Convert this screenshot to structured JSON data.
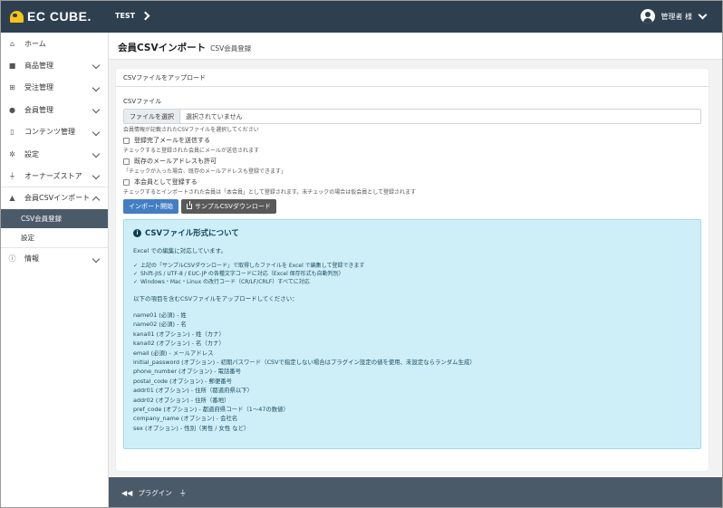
{
  "header": {
    "logo_text": "EC CUBE.",
    "shop_name": "TEST",
    "user_name": "管理者 様"
  },
  "sidebar": {
    "items": [
      {
        "label": "ホーム",
        "icon": "home-icon"
      },
      {
        "label": "商品管理",
        "icon": "box-icon"
      },
      {
        "label": "受注管理",
        "icon": "cart-icon"
      },
      {
        "label": "会員管理",
        "icon": "users-icon"
      },
      {
        "label": "コンテンツ管理",
        "icon": "document-icon"
      },
      {
        "label": "設定",
        "icon": "gear-icon"
      },
      {
        "label": "オーナーズストア",
        "icon": "plug-icon"
      },
      {
        "label": "会員CSVインポート",
        "icon": "user-upload-icon"
      },
      {
        "label": "情報",
        "icon": "info-icon"
      }
    ],
    "sub_items": [
      {
        "label": "CSV会員登録"
      },
      {
        "label": "設定"
      }
    ]
  },
  "page": {
    "title": "会員CSVインポート",
    "subtitle": "CSV会員登録"
  },
  "upload": {
    "card_title": "CSVファイルをアップロード",
    "file_label": "CSVファイル",
    "file_button": "ファイルを選択",
    "file_status": "選択されていません",
    "file_help": "会員情報が記載されたCSVファイルを選択してください",
    "check1": "登録完了メールを送信する",
    "check1_help": "チェックすると登録された会員にメールが送信されます",
    "check2": "既存のメールアドレスも許可",
    "check2_help": "「チェックが入った場合、既存のメールアドレスも登録できます」",
    "check3": "本会員として登録する",
    "check3_help": "チェックするとインポートされた会員は「本会員」として登録されます。未チェックの場合は仮会員として登録されます",
    "import_button": "インポート開始",
    "sample_button": "サンプルCSVダウンロード"
  },
  "info": {
    "title": "CSVファイル形式について",
    "intro": "Excel での編集に対応しています。",
    "features": [
      "上記の「サンプルCSVダウンロード」で取得したファイルを Excel で編集して登録できます",
      "Shift-JIS / UTF-8 / EUC-JP の各種文字コードに対応（Excel 保存形式も自動判別）",
      "Windows・Mac・Linux の改行コード（CR/LF/CRLF）すべてに対応"
    ],
    "columns_intro": "以下の項目を含むCSVファイルをアップロードしてください：",
    "columns": [
      "name01 (必須) - 姓",
      "name02 (必須) - 名",
      "kana01 (オプション) - 姓（カナ）",
      "kana02 (オプション) - 名（カナ）",
      "email (必須) - メールアドレス",
      "initial_password (オプション) - 初期パスワード（CSVで指定しない場合はプラグイン設定の値を使用、未設定ならランダム生成）",
      "phone_number (オプション) - 電話番号",
      "postal_code (オプション) - 郵便番号",
      "addr01 (オプション) - 住所（都道府県以下）",
      "addr02 (オプション) - 住所（番地）",
      "pref_code (オプション) - 都道府県コード（1〜47の数値）",
      "company_name (オプション) - 会社名",
      "sex (オプション) - 性別（男性 / 女性 など）"
    ]
  },
  "footer": {
    "label": "プラグイン"
  }
}
